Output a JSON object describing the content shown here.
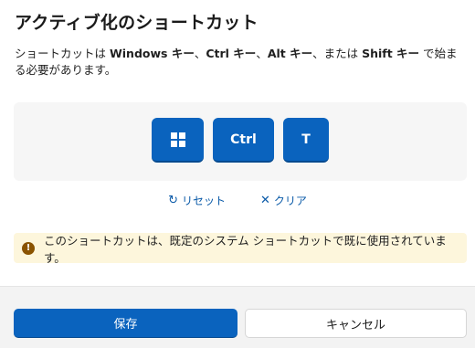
{
  "dialog": {
    "title": "アクティブ化のショートカット",
    "description": {
      "p1": "ショートカットは ",
      "k1": "Windows キー",
      "p2": "、",
      "k2": "Ctrl キー",
      "p3": "、",
      "k3": "Alt キー",
      "p4": "、または ",
      "k4": "Shift キー",
      "p5": " で始まる必要があります。"
    }
  },
  "keys": [
    {
      "icon": "windows-logo-icon"
    },
    {
      "label": "Ctrl"
    },
    {
      "label": "T"
    }
  ],
  "actions": {
    "reset_icon": "↻",
    "reset_label": "リセット",
    "clear_icon": "✕",
    "clear_label": "クリア"
  },
  "warning": {
    "icon_glyph": "!",
    "message": "このショートカットは、既定のシステム ショートカットで既に使用されています。"
  },
  "footer": {
    "save_label": "保存",
    "cancel_label": "キャンセル"
  },
  "colors": {
    "accent": "#0a63be",
    "warning_bg": "#fdf6dc",
    "warning_icon": "#8a5300",
    "link": "#0a5aa8"
  }
}
